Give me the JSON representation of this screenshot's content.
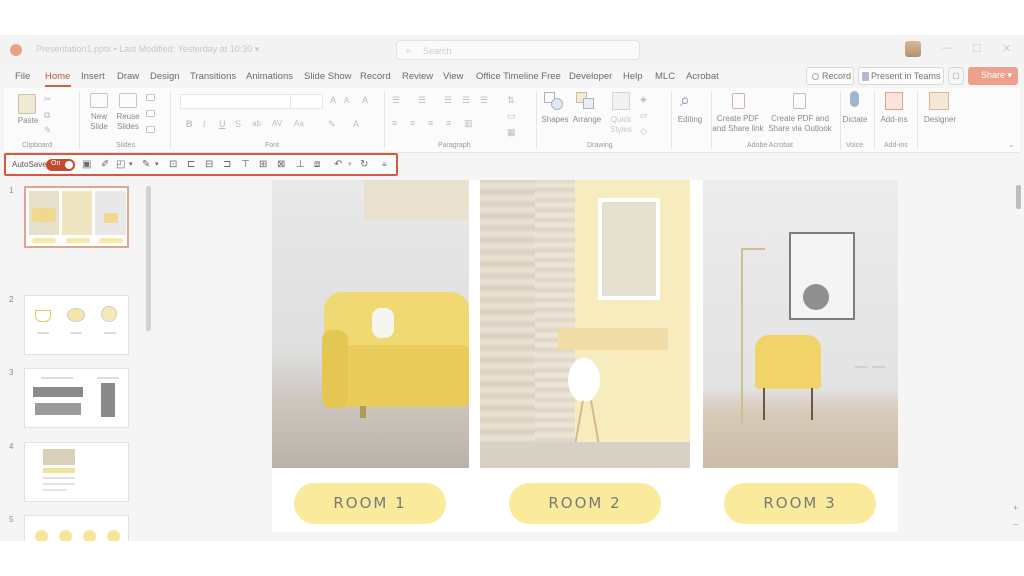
{
  "window": {
    "doc_title": "Presentation1.pptx • Last Modified: Yesterday at 10:30 ▾",
    "search_placeholder": "Search",
    "minimize": "—",
    "maximize": "☐",
    "close": "✕"
  },
  "menu": {
    "tabs": [
      "File",
      "Home",
      "Insert",
      "Draw",
      "Design",
      "Transitions",
      "Animations",
      "Slide Show",
      "Record",
      "Review",
      "View",
      "Office Timeline Free",
      "Developer",
      "Help",
      "MLC",
      "Acrobat"
    ],
    "active": "Home",
    "record_label": "Record",
    "teams_label": "Present in Teams",
    "share_label": "Share ▾"
  },
  "ribbon": {
    "clipboard": {
      "label": "Clipboard",
      "paste": "Paste"
    },
    "slides": {
      "label": "Slides",
      "new_slide": "New\nSlide",
      "reuse_slides": "Reuse\nSlides"
    },
    "font": {
      "label": "Font"
    },
    "paragraph": {
      "label": "Paragraph"
    },
    "drawing": {
      "label": "Drawing",
      "shapes": "Shapes",
      "arrange": "Arrange",
      "quick_styles": "Quick\nStyles"
    },
    "editing": {
      "label": "Editing"
    },
    "adobe": {
      "label": "Adobe Acrobat",
      "create_pdf_share": "Create PDF\nand Share link",
      "create_pdf_outlook": "Create PDF and\nShare via Outlook"
    },
    "voice": {
      "label": "Voice",
      "dictate": "Dictate"
    },
    "addins": {
      "label": "Add-ins",
      "addins_btn": "Add-ins"
    },
    "designer": {
      "label": "Designer"
    }
  },
  "qat": {
    "autosave_label": "AutoSave",
    "autosave_state": "On"
  },
  "slides_panel": {
    "thumbnails": [
      {
        "num": "1",
        "selected": true
      },
      {
        "num": "2",
        "selected": false
      },
      {
        "num": "3",
        "selected": false
      },
      {
        "num": "4",
        "selected": false
      },
      {
        "num": "5",
        "selected": false
      }
    ]
  },
  "slide": {
    "rooms": [
      "ROOM 1",
      "ROOM 2",
      "ROOM 3"
    ]
  },
  "colors": {
    "accent": "#c8634a",
    "highlight_border": "#d9573c",
    "pill": "#faeb9c",
    "toggle": "#c84a2c"
  }
}
